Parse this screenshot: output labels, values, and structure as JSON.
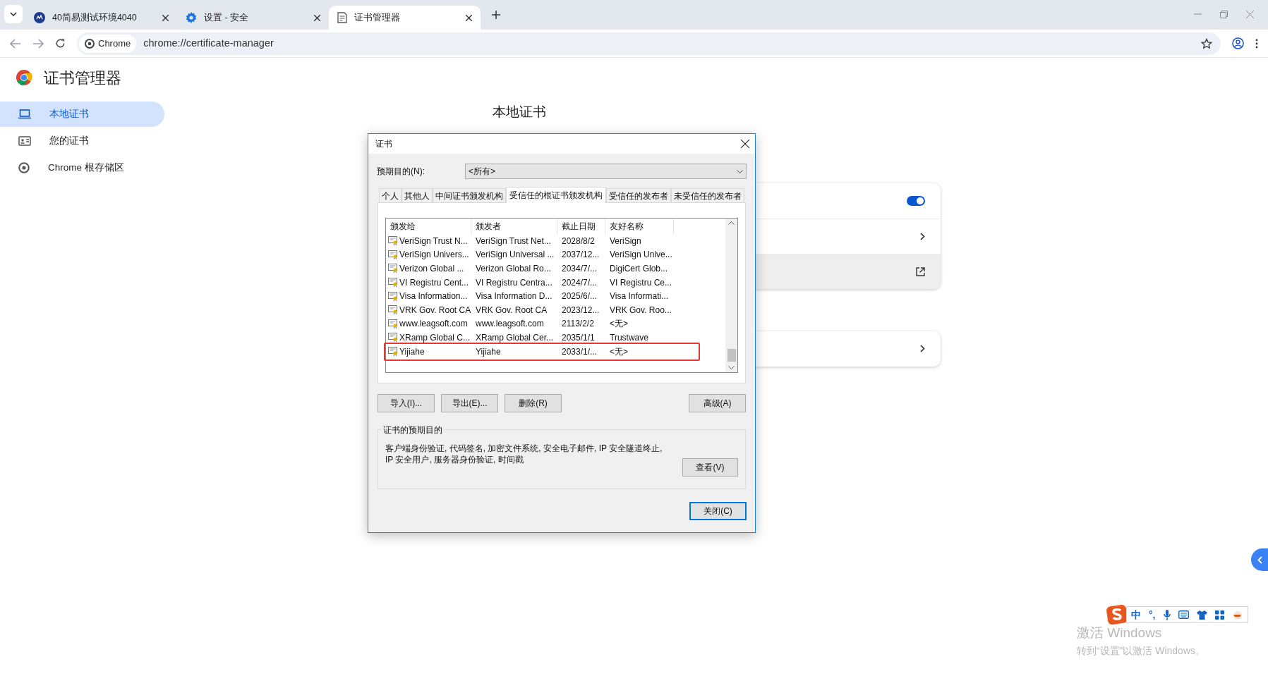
{
  "browser": {
    "tabs": [
      {
        "title": "40简易测试环境4040",
        "selected": false,
        "kind": "site"
      },
      {
        "title": "设置 - 安全",
        "selected": false,
        "kind": "settings"
      },
      {
        "title": "证书管理器",
        "selected": true,
        "kind": "document"
      }
    ],
    "chip": "Chrome",
    "url": "chrome://certificate-manager"
  },
  "page": {
    "title": "证书管理器",
    "sidebar": [
      {
        "label": "本地证书",
        "selected": true,
        "kind": "laptop"
      },
      {
        "label": "您的证书",
        "selected": false,
        "kind": "card"
      },
      {
        "label": "Chrome 根存储区",
        "selected": false,
        "kind": "chrome"
      }
    ],
    "heading": "本地证书",
    "cards": [
      {
        "rows": [
          {
            "kind": "toggle",
            "on": true
          },
          {
            "kind": "chevron"
          },
          {
            "kind": "external"
          }
        ]
      },
      {
        "rows": [
          {
            "kind": "chevron"
          }
        ]
      }
    ]
  },
  "dialog": {
    "title": "证书",
    "purpose_label": "预期目的(N):",
    "purpose_value": "<所有>",
    "tabs": [
      {
        "label": "个人",
        "selected": false
      },
      {
        "label": "其他人",
        "selected": false
      },
      {
        "label": "中间证书颁发机构",
        "selected": false
      },
      {
        "label": "受信任的根证书颁发机构",
        "selected": true
      },
      {
        "label": "受信任的发布者",
        "selected": false
      },
      {
        "label": "未受信任的发布者",
        "selected": false
      }
    ],
    "columns": [
      "颁发给",
      "颁发者",
      "截止日期",
      "友好名称"
    ],
    "rows": [
      {
        "cells": [
          "VeriSign Trust N...",
          "VeriSign Trust Net...",
          "2028/8/2",
          "VeriSign"
        ],
        "highlighted": false
      },
      {
        "cells": [
          "VeriSign Univers...",
          "VeriSign Universal ...",
          "2037/12...",
          "VeriSign Unive..."
        ],
        "highlighted": false
      },
      {
        "cells": [
          "Verizon Global ...",
          "Verizon Global Ro...",
          "2034/7/...",
          "DigiCert Glob..."
        ],
        "highlighted": false
      },
      {
        "cells": [
          "VI Registru Cent...",
          "VI Registru Centra...",
          "2024/7/...",
          "VI Registru Ce..."
        ],
        "highlighted": false
      },
      {
        "cells": [
          "Visa Information...",
          "Visa Information D...",
          "2025/6/...",
          "Visa Informati..."
        ],
        "highlighted": false
      },
      {
        "cells": [
          "VRK Gov. Root CA",
          "VRK Gov. Root CA",
          "2023/12...",
          "VRK Gov. Roo..."
        ],
        "highlighted": false
      },
      {
        "cells": [
          "www.leagsoft.com",
          "www.leagsoft.com",
          "2113/2/2",
          "<无>"
        ],
        "highlighted": false
      },
      {
        "cells": [
          "XRamp Global C...",
          "XRamp Global Cer...",
          "2035/1/1",
          "Trustwave"
        ],
        "highlighted": false
      },
      {
        "cells": [
          "Yijiahe",
          "Yijiahe",
          "2033/1/...",
          "<无>"
        ],
        "highlighted": true
      }
    ],
    "buttons": [
      "导入(I)...",
      "导出(E)...",
      "删除(R)"
    ],
    "advanced": "高级(A)",
    "group_title": "证书的预期目的",
    "purposes": "客户端身份验证, 代码签名, 加密文件系统, 安全电子邮件, IP 安全隧道终止, IP 安全用户, 服务器身份验证, 时间戳",
    "view": "查看(V)",
    "close": "关闭(C)"
  },
  "ime": {
    "mode": "中",
    "punct": "°,"
  },
  "activation": {
    "title": "激活 Windows",
    "subtitle": "转到“设置”以激活 Windows。"
  }
}
